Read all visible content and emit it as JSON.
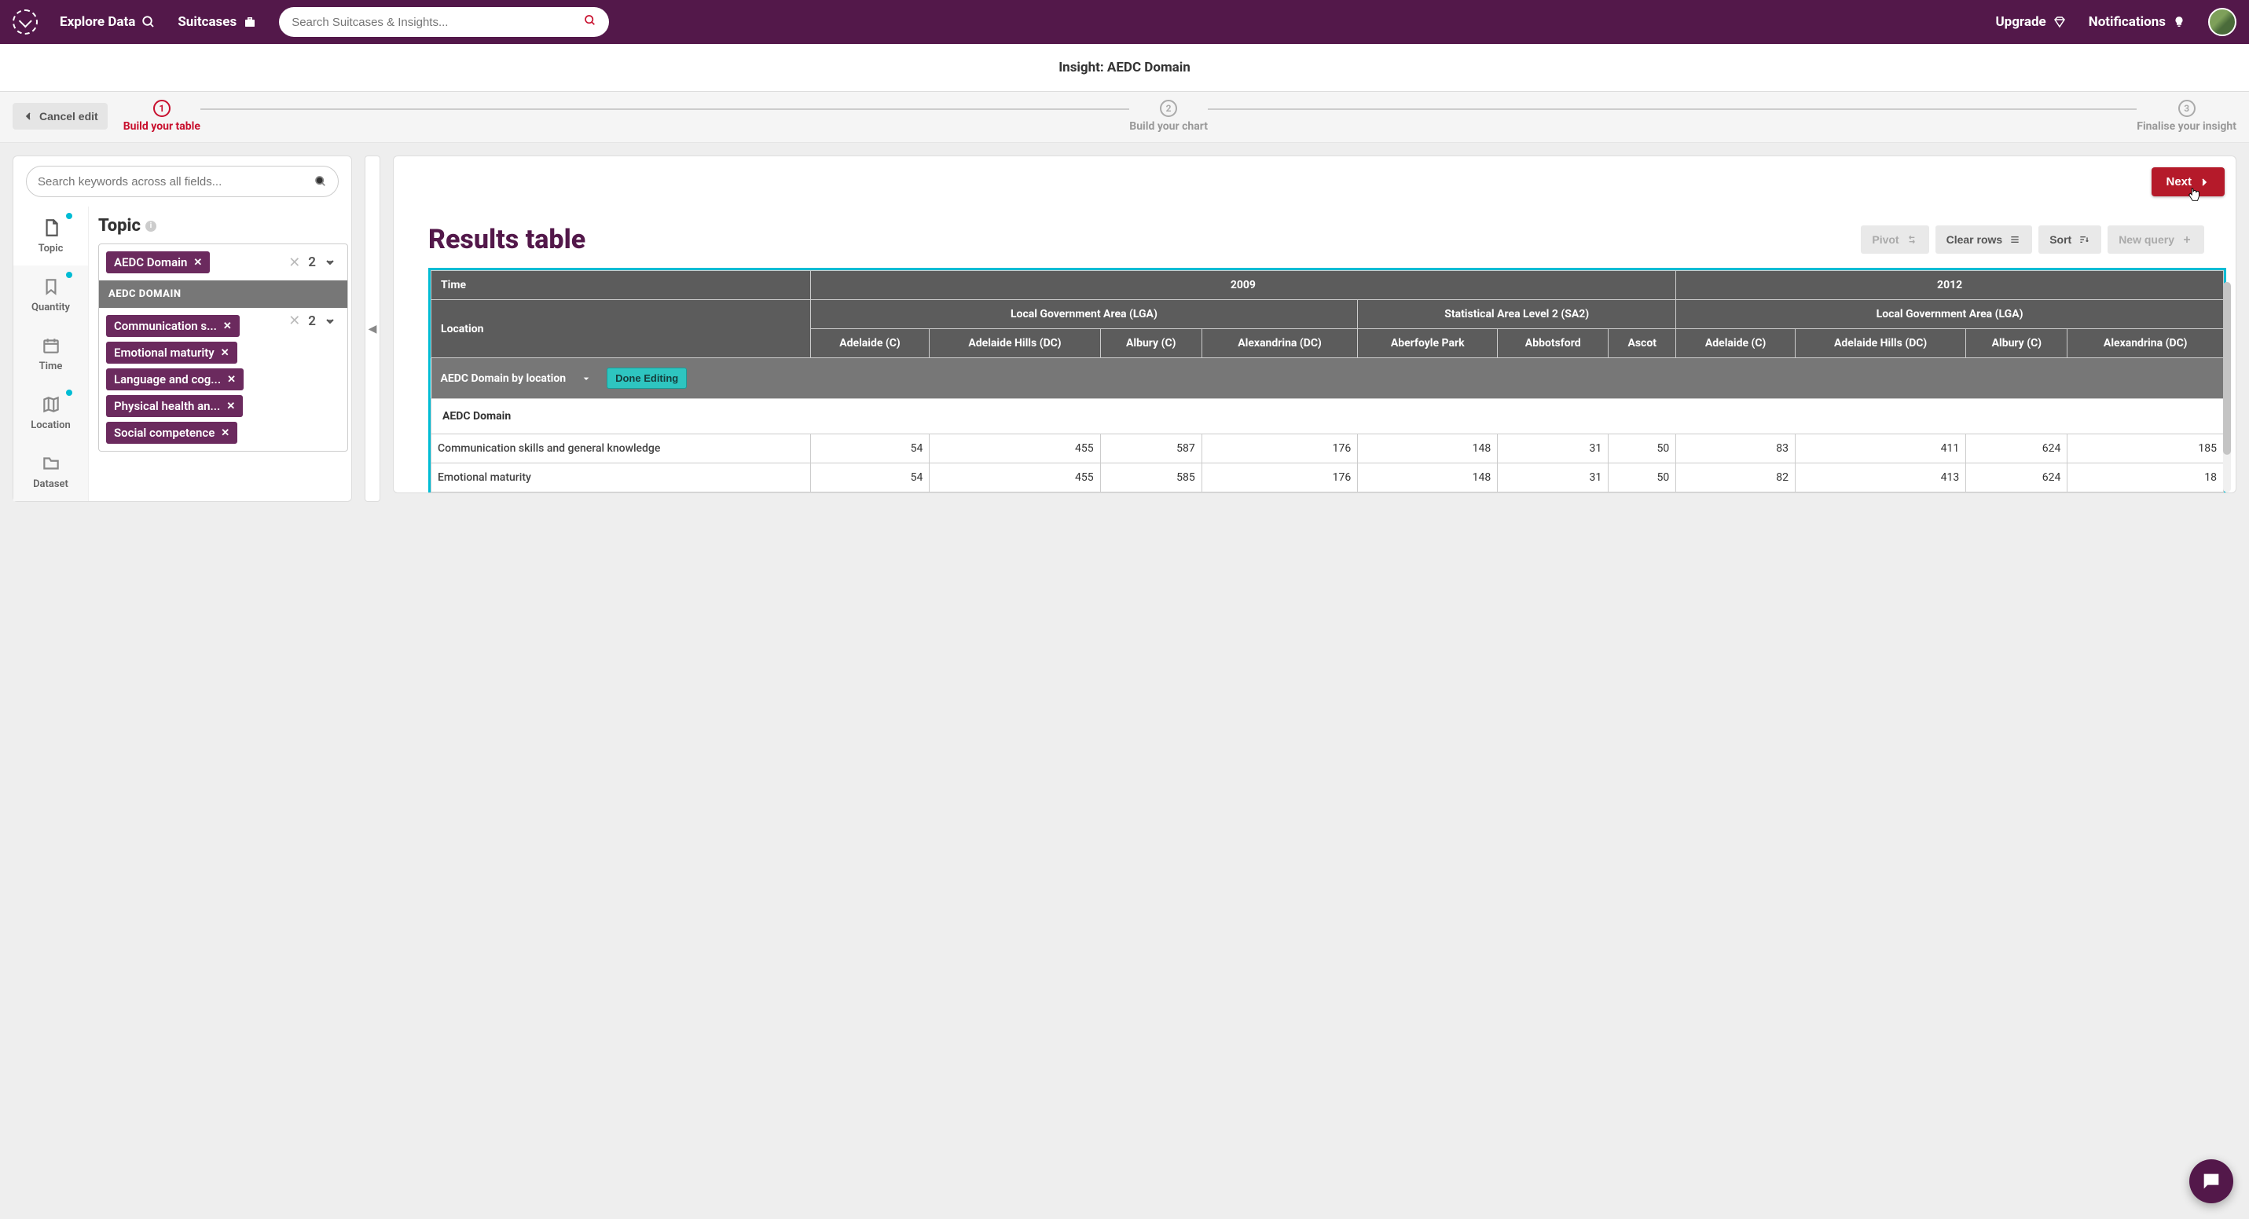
{
  "header": {
    "explore": "Explore Data",
    "suitcases": "Suitcases",
    "search_placeholder": "Search Suitcases & Insights...",
    "upgrade": "Upgrade",
    "notifications": "Notifications"
  },
  "insight_title": "Insight: AEDC Domain",
  "cancel_edit": "Cancel edit",
  "steps": [
    {
      "num": "1",
      "label": "Build your table"
    },
    {
      "num": "2",
      "label": "Build your chart"
    },
    {
      "num": "3",
      "label": "Finalise your insight"
    }
  ],
  "field_search_placeholder": "Search keywords across all fields...",
  "side_tabs": [
    {
      "label": "Topic",
      "dot": true
    },
    {
      "label": "Quantity",
      "dot": true
    },
    {
      "label": "Time",
      "dot": false
    },
    {
      "label": "Location",
      "dot": true
    },
    {
      "label": "Dataset",
      "dot": false
    }
  ],
  "topic": {
    "title": "Topic",
    "primary_chip": "AEDC Domain",
    "primary_count": "2",
    "section_header": "AEDC DOMAIN",
    "chips": [
      "Communication s...",
      "Emotional maturity",
      "Language and cog...",
      "Physical health an...",
      "Social competence"
    ],
    "secondary_count": "2"
  },
  "results": {
    "title": "Results table",
    "buttons": {
      "pivot": "Pivot",
      "clear": "Clear rows",
      "sort": "Sort",
      "new_query": "New query"
    },
    "next": "Next",
    "section_title": "AEDC Domain by location",
    "done_editing": "Done Editing",
    "domain_header": "AEDC Domain",
    "time_label": "Time",
    "location_label": "Location",
    "years": [
      "2009",
      "2012"
    ],
    "region_groups": [
      "Local Government Area (LGA)",
      "Statistical Area Level 2 (SA2)",
      "Local Government Area (LGA)"
    ],
    "columns": [
      "Adelaide (C)",
      "Adelaide Hills (DC)",
      "Albury (C)",
      "Alexandrina (DC)",
      "Aberfoyle Park",
      "Abbotsford",
      "Ascot",
      "Adelaide (C)",
      "Adelaide Hills (DC)",
      "Albury (C)",
      "Alexandrina (DC)"
    ],
    "rows": [
      {
        "label": "Communication skills and general knowledge",
        "vals": [
          "54",
          "455",
          "587",
          "176",
          "148",
          "31",
          "50",
          "83",
          "411",
          "624",
          "185"
        ]
      },
      {
        "label": "Emotional maturity",
        "vals": [
          "54",
          "455",
          "585",
          "176",
          "148",
          "31",
          "50",
          "82",
          "413",
          "624",
          "18"
        ]
      }
    ]
  }
}
